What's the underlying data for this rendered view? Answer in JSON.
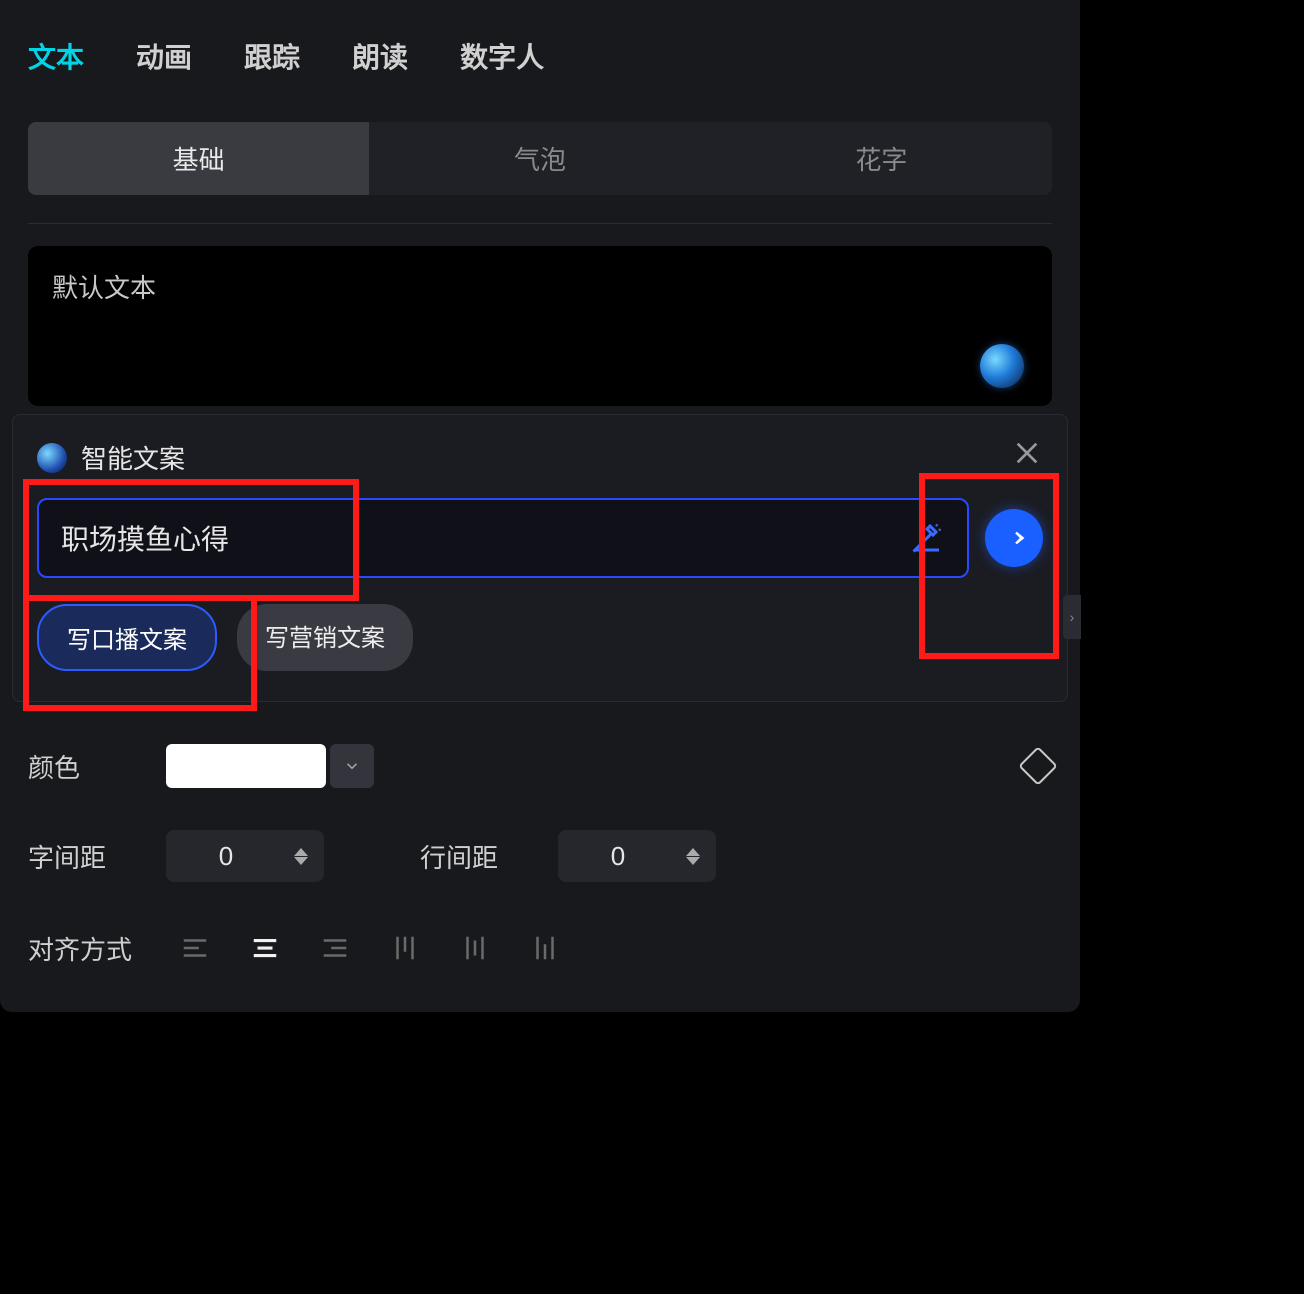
{
  "topTabs": {
    "items": [
      "文本",
      "动画",
      "跟踪",
      "朗读",
      "数字人"
    ],
    "activeIndex": 0
  },
  "subTabs": {
    "items": [
      "基础",
      "气泡",
      "花字"
    ],
    "activeIndex": 0
  },
  "textArea": {
    "value": "默认文本"
  },
  "smartCopy": {
    "title": "智能文案",
    "input": "职场摸鱼心得",
    "pills": [
      "写口播文案",
      "写营销文案"
    ],
    "selectedPill": 0
  },
  "props": {
    "colorLabel": "颜色",
    "colorValue": "#FFFFFF",
    "letterSpacingLabel": "字间距",
    "letterSpacingValue": "0",
    "lineSpacingLabel": "行间距",
    "lineSpacingValue": "0",
    "alignLabel": "对齐方式"
  }
}
